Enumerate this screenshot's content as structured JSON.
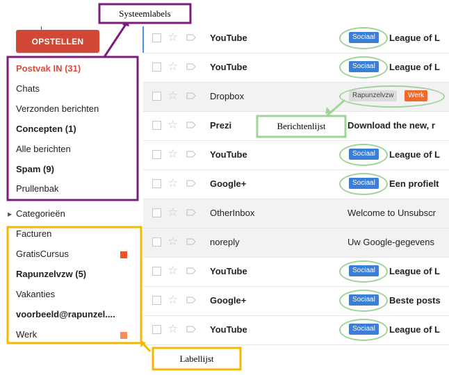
{
  "compose_label": "OPSTELLEN",
  "system_labels": [
    {
      "label": "Postvak IN (31)",
      "style": "active"
    },
    {
      "label": "Chats",
      "style": "normal"
    },
    {
      "label": "Verzonden berichten",
      "style": "normal"
    },
    {
      "label": "Concepten (1)",
      "style": "bold"
    },
    {
      "label": "Alle berichten",
      "style": "normal"
    },
    {
      "label": "Spam (9)",
      "style": "bold"
    },
    {
      "label": "Prullenbak",
      "style": "normal"
    }
  ],
  "categories_label": "Categorieën",
  "user_labels": [
    {
      "label": "Facturen",
      "style": "normal"
    },
    {
      "label": "GratisCursus",
      "style": "normal",
      "color": "#f4511e"
    },
    {
      "label": "Rapunzelvzw (5)",
      "style": "bold"
    },
    {
      "label": "Vakanties",
      "style": "normal"
    },
    {
      "label": "voorbeeld@rapunzel....",
      "style": "bold"
    },
    {
      "label": "Werk",
      "style": "normal",
      "color": "#fb8c5a"
    }
  ],
  "messages": [
    {
      "sender": "YouTube",
      "bold": true,
      "read": false,
      "badges": [
        "Sociaal"
      ],
      "subject": "League of L"
    },
    {
      "sender": "YouTube",
      "bold": true,
      "read": false,
      "badges": [
        "Sociaal"
      ],
      "subject": "League of L"
    },
    {
      "sender": "Dropbox",
      "bold": false,
      "read": true,
      "badges": [
        "Rapunzelvzw",
        "Werk"
      ],
      "subject": ""
    },
    {
      "sender": "Prezi",
      "bold": true,
      "read": false,
      "badges": [],
      "subject": "Download the new, r"
    },
    {
      "sender": "YouTube",
      "bold": true,
      "read": false,
      "badges": [
        "Sociaal"
      ],
      "subject": "League of L"
    },
    {
      "sender": "Google+",
      "bold": true,
      "read": false,
      "badges": [
        "Sociaal"
      ],
      "subject": "Een profielt"
    },
    {
      "sender": "OtherInbox",
      "bold": false,
      "read": true,
      "badges": [],
      "subject": "Welcome to Unsubscr"
    },
    {
      "sender": "noreply",
      "bold": false,
      "read": true,
      "badges": [],
      "subject": "Uw Google-gegevens"
    },
    {
      "sender": "YouTube",
      "bold": true,
      "read": false,
      "badges": [
        "Sociaal"
      ],
      "subject": "League of L"
    },
    {
      "sender": "Google+",
      "bold": true,
      "read": false,
      "badges": [
        "Sociaal"
      ],
      "subject": "Beste posts"
    },
    {
      "sender": "YouTube",
      "bold": true,
      "read": false,
      "badges": [
        "Sociaal"
      ],
      "subject": "League of L"
    }
  ],
  "callouts": {
    "system": "Systeemlabels",
    "messages": "Berichtenlijst",
    "labels": "Labellijst"
  },
  "colors": {
    "compose": "#d14836",
    "purple": "#7b1e7a",
    "yellow": "#f6b800",
    "green": "#9fd39a",
    "sociaal": "#3b7ed8",
    "werk": "#f06a2c"
  }
}
